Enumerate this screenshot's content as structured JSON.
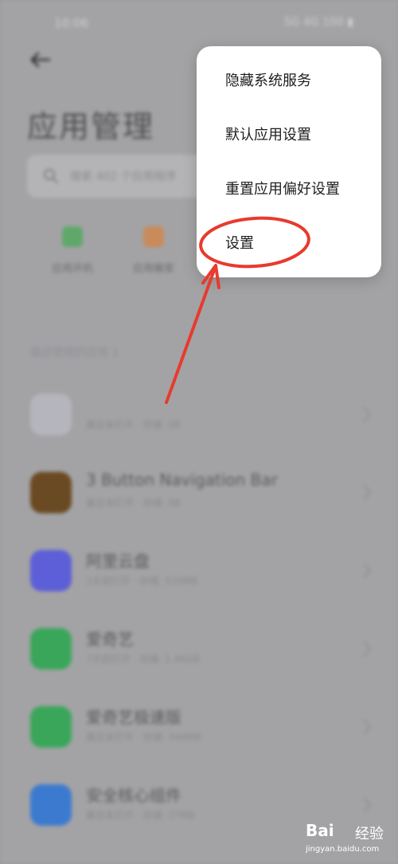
{
  "status_bar": {
    "time": "10:06",
    "indicators": "5G 4G 100 ▮"
  },
  "header": {
    "title": "应用管理"
  },
  "search": {
    "placeholder": "搜索 402 个应用程序"
  },
  "quick_actions": [
    {
      "label": "应用开机",
      "color": "#5fa86a"
    },
    {
      "label": "应用搬家",
      "color": "#c98b5a"
    }
  ],
  "section": {
    "title": "最近使用的应用 1"
  },
  "apps": [
    {
      "name": "",
      "meta": "最近未打开 · 存储: 0B",
      "color": "#b5b5bd"
    },
    {
      "name": "3 Button Navigation Bar",
      "meta": "最近未打开 · 存储: 0B",
      "color": "#6a4a22"
    },
    {
      "name": "阿里云盘",
      "meta": "2天前打开 · 存储: 510MB",
      "color": "#5d5fd8"
    },
    {
      "name": "爱奇艺",
      "meta": "7天前打开 · 存储: 1.46GB",
      "color": "#3aa65a"
    },
    {
      "name": "爱奇艺极速版",
      "meta": "最近未打开 · 存储: 348MB",
      "color": "#3aa65a"
    },
    {
      "name": "安全核心组件",
      "meta": "最近未打开 · 存储: 27MB",
      "color": "#3c7ad0"
    }
  ],
  "menu": {
    "items": [
      "隐藏系统服务",
      "默认应用设置",
      "重置应用偏好设置",
      "设置"
    ]
  },
  "annotation": {
    "color": "#e83a2e"
  },
  "watermark": {
    "logo": "Bai",
    "cn": "经验",
    "url": "jingyan.baidu.com"
  }
}
